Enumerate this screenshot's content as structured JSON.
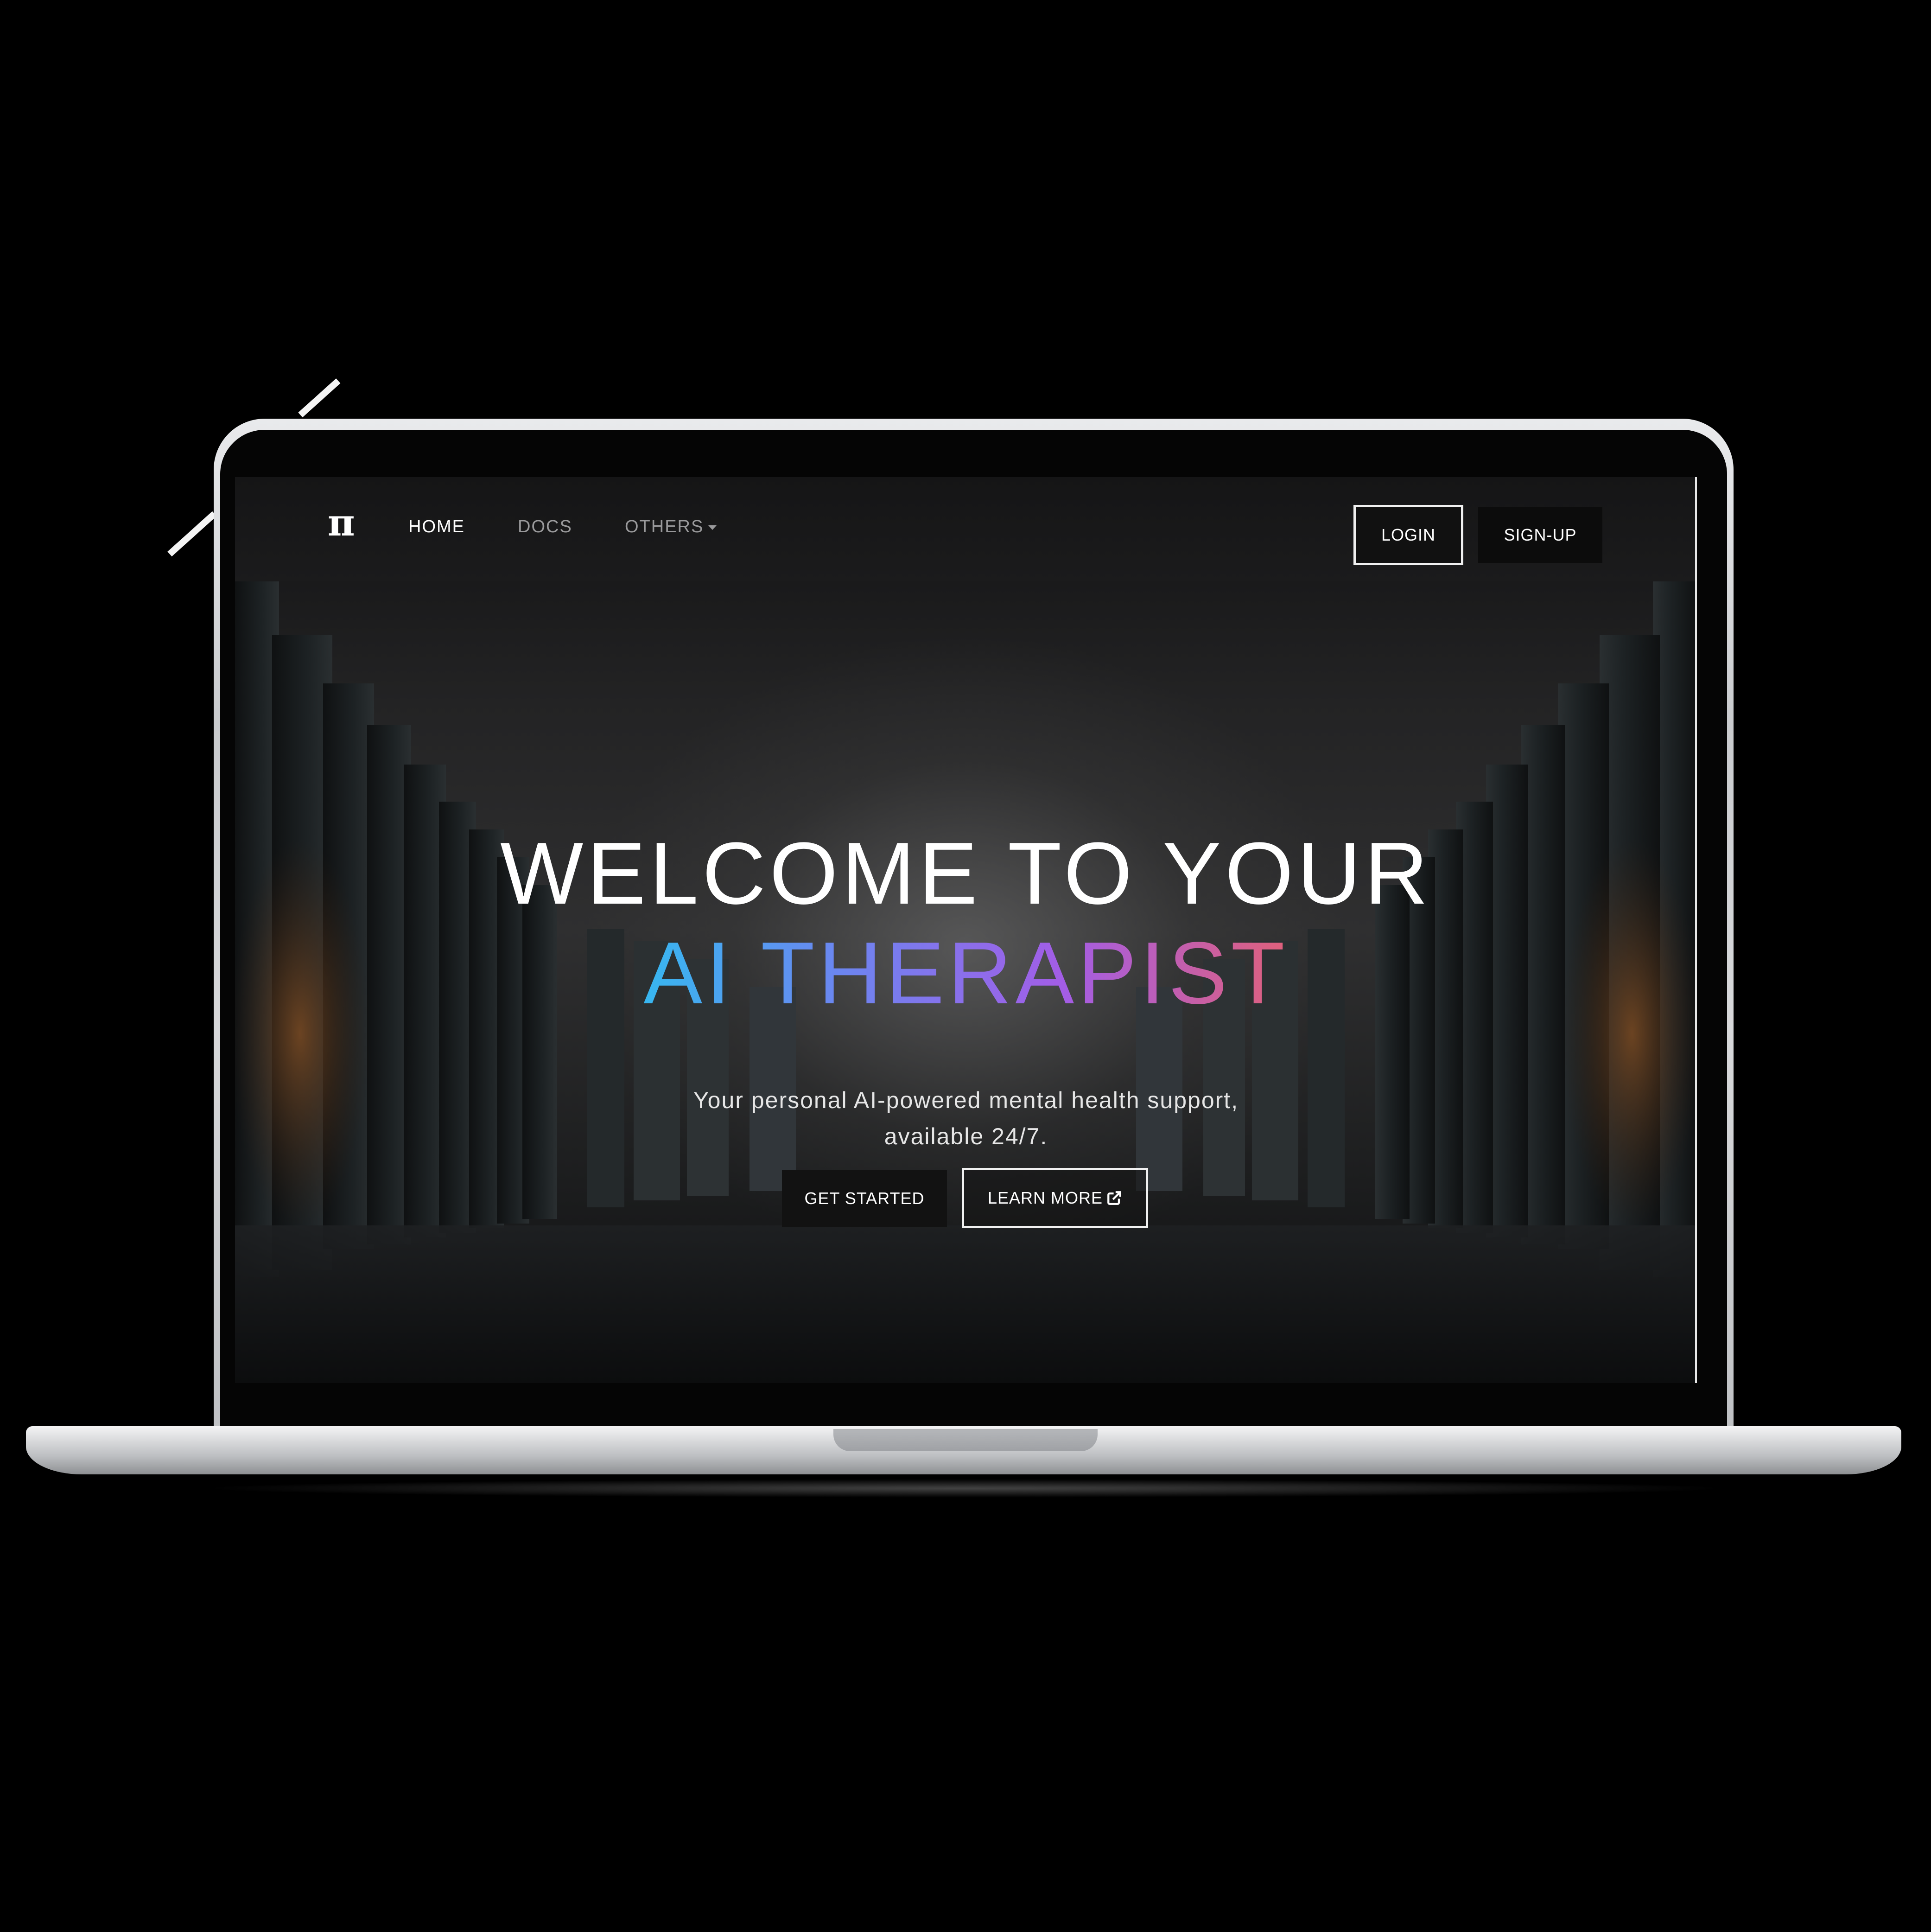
{
  "navbar": {
    "brand": "π",
    "links": [
      {
        "label": "HOME"
      },
      {
        "label": "DOCS"
      },
      {
        "label": "OTHERS"
      }
    ],
    "login_label": "LOGIN",
    "signup_label": "SIGN-UP"
  },
  "hero": {
    "title_line1": "WELCOME TO YOUR",
    "title_line2": "AI THERAPIST",
    "subtitle_line1": "Your personal AI-powered mental health support,",
    "subtitle_line2": "available 24/7.",
    "primary_button": "GET STARTED",
    "secondary_button": "LEARN MORE",
    "secondary_icon": "external-link-icon"
  },
  "colors": {
    "background": "#000000",
    "screen": "#161617",
    "title_gradient": [
      "#37b7f0",
      "#6b86f0",
      "#a35de6",
      "#e0607a"
    ]
  }
}
